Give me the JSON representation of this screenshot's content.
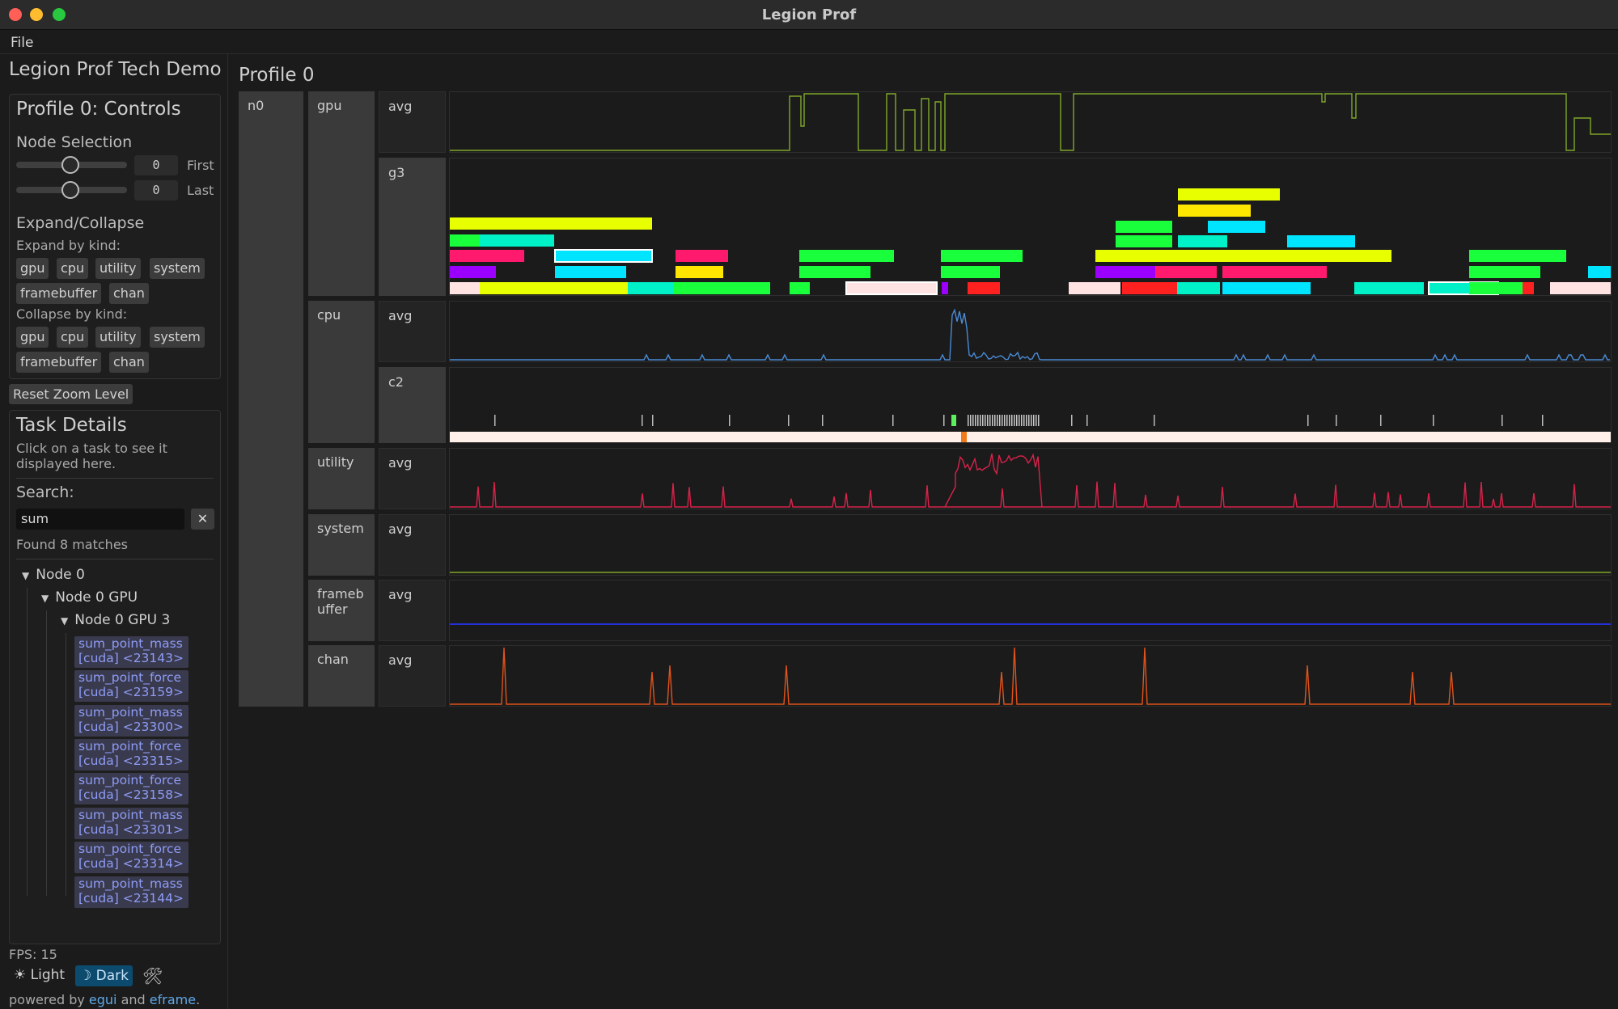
{
  "window": {
    "title": "Legion Prof"
  },
  "menu": {
    "file": "File"
  },
  "sidebar": {
    "app_title": "Legion Prof Tech Demo",
    "controls": {
      "title": "Profile 0: Controls",
      "node_selection": "Node Selection",
      "first_value": "0",
      "first_label": "First",
      "last_value": "0",
      "last_label": "Last",
      "expand_collapse": "Expand/Collapse",
      "expand_by_kind": "Expand by kind:",
      "collapse_by_kind": "Collapse by kind:",
      "kinds": [
        "gpu",
        "cpu",
        "utility",
        "system",
        "framebuffer",
        "chan"
      ]
    },
    "reset_zoom": "Reset Zoom Level",
    "task_details": {
      "title": "Task Details",
      "hint_line1": "Click on a task to see it",
      "hint_line2": "displayed here.",
      "search_label": "Search:",
      "search_value": "sum",
      "clear_label": "✕",
      "found": "Found 8 matches",
      "tree": {
        "node": "Node 0",
        "gpu": "Node 0 GPU",
        "gpu_unit": "Node 0 GPU 3"
      },
      "results": [
        {
          "name": "sum_point_mass",
          "detail": "[cuda] <23143>"
        },
        {
          "name": "sum_point_force",
          "detail": "[cuda] <23159>"
        },
        {
          "name": "sum_point_mass",
          "detail": "[cuda] <23300>"
        },
        {
          "name": "sum_point_force",
          "detail": "[cuda] <23315>"
        },
        {
          "name": "sum_point_force",
          "detail": "[cuda] <23158>"
        },
        {
          "name": "sum_point_mass",
          "detail": "[cuda] <23301>"
        },
        {
          "name": "sum_point_force",
          "detail": "[cuda] <23314>"
        },
        {
          "name": "sum_point_mass",
          "detail": "[cuda] <23144>"
        }
      ]
    },
    "fps": "FPS: 15",
    "theme": {
      "light": "☀ Light",
      "dark": "☽ Dark",
      "tools_icon": "🛠"
    },
    "footer": {
      "prefix": "powered by ",
      "egui": "egui",
      "and": " and ",
      "eframe": "eframe",
      "suffix": "."
    }
  },
  "profile": {
    "title": "Profile 0",
    "node": "n0",
    "rows": {
      "gpu": {
        "kind": "gpu",
        "avg": "avg",
        "sub": "g3"
      },
      "cpu": {
        "kind": "cpu",
        "avg": "avg",
        "sub": "c2"
      },
      "utility": {
        "kind": "utility",
        "avg": "avg"
      },
      "system": {
        "kind": "system",
        "avg": "avg"
      },
      "framebuffer": {
        "kind": "frameb\nuffer",
        "avg": "avg"
      },
      "chan": {
        "kind": "chan",
        "avg": "avg"
      }
    },
    "colors": {
      "gpu_avg": "#7fa82a",
      "cpu_avg": "#4a8ad4",
      "utility_avg": "#d8234a",
      "system_avg": "#7fa82a",
      "framebuffer_avg": "#2430d8",
      "chan_avg": "#e0531a"
    }
  }
}
